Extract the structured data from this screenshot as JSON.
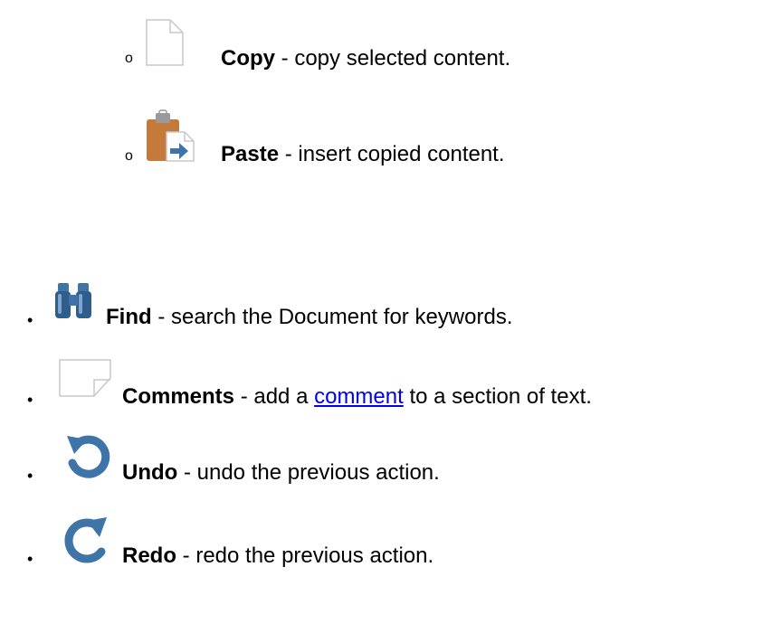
{
  "sub_bullet_char": "o",
  "bullet_char": "•",
  "items": [
    {
      "icon": "copy-icon",
      "label": "Copy",
      "desc": " - copy selected content."
    },
    {
      "icon": "paste-icon",
      "label": "Paste",
      "desc": " - insert copied content."
    },
    {
      "icon": "find-binoculars-icon",
      "label": "Find",
      "desc": " - search the Document for keywords."
    },
    {
      "icon": "comment-icon",
      "label": "Comments",
      "desc_before": " - add a ",
      "link": "comment",
      "desc_after": " to a section of text."
    },
    {
      "icon": "undo-icon",
      "label": "Undo",
      "desc": " - undo the previous action."
    },
    {
      "icon": "redo-icon",
      "label": "Redo",
      "desc": " - redo the previous action."
    }
  ],
  "colors": {
    "link": "#0000ee",
    "icon_blue": "#3f74a8",
    "icon_brown": "#c47a3a",
    "icon_outline": "#c8c8c8"
  }
}
